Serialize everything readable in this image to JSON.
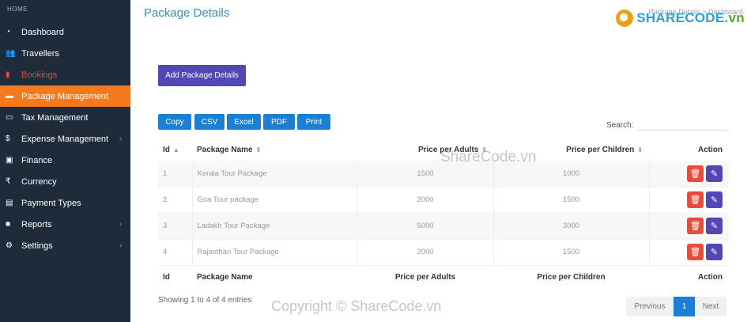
{
  "sidebar": {
    "home": "HOME",
    "items": [
      {
        "label": "Dashboard",
        "icon": "dashboard-icon",
        "glyph": "◔",
        "chevron": ""
      },
      {
        "label": "Travellers",
        "icon": "users-icon",
        "glyph": "👥",
        "chevron": ""
      },
      {
        "label": "Bookings",
        "icon": "book-icon",
        "glyph": "▮",
        "chevron": ""
      },
      {
        "label": "Package Management",
        "icon": "briefcase-icon",
        "glyph": "▬",
        "chevron": ""
      },
      {
        "label": "Tax Management",
        "icon": "card-icon",
        "glyph": "▭",
        "chevron": ""
      },
      {
        "label": "Expense Management",
        "icon": "dollar-icon",
        "glyph": "$",
        "chevron": "›"
      },
      {
        "label": "Finance",
        "icon": "money-icon",
        "glyph": "▣",
        "chevron": ""
      },
      {
        "label": "Currency",
        "icon": "rupee-icon",
        "glyph": "₹",
        "chevron": ""
      },
      {
        "label": "Payment Types",
        "icon": "wallet-icon",
        "glyph": "▤",
        "chevron": ""
      },
      {
        "label": "Reports",
        "icon": "file-icon",
        "glyph": "■",
        "chevron": "›"
      },
      {
        "label": "Settings",
        "icon": "gear-icon",
        "glyph": "⚙",
        "chevron": "›"
      }
    ],
    "active_color": "#f47a20"
  },
  "header": {
    "title": "Package Details",
    "breadcrumb": "Package Details  >  Dashboard"
  },
  "logo": {
    "brand": "SHARECODE",
    "suffix": ".vn"
  },
  "actions": {
    "add_label": "Add Package Details"
  },
  "export_buttons": [
    "Copy",
    "CSV",
    "Excel",
    "PDF",
    "Print"
  ],
  "search": {
    "label": "Search:",
    "value": ""
  },
  "table": {
    "columns": [
      "Id",
      "Package Name",
      "Price per Adults",
      "Price per Children",
      "Action"
    ],
    "rows": [
      {
        "id": "1",
        "name": "Kerala Tour Package",
        "adults": "1500",
        "children": "1000"
      },
      {
        "id": "2",
        "name": "Goa Tour package",
        "adults": "2000",
        "children": "1500"
      },
      {
        "id": "3",
        "name": "Ladakh Tour Package",
        "adults": "5000",
        "children": "3000"
      },
      {
        "id": "4",
        "name": "Rajasthan Tour Package",
        "adults": "2000",
        "children": "1500"
      }
    ]
  },
  "footer": {
    "info": "Showing 1 to 4 of 4 entries",
    "prev": "Previous",
    "page": "1",
    "next": "Next"
  },
  "watermarks": {
    "center": "ShareCode.vn",
    "bottom": "Copyright © ShareCode.vn"
  },
  "colors": {
    "primary": "#5346b5",
    "export": "#1c7fd6",
    "title": "#3a8fc6",
    "danger": "#e74c3c",
    "sidebar_bg": "#1e2b3a"
  }
}
